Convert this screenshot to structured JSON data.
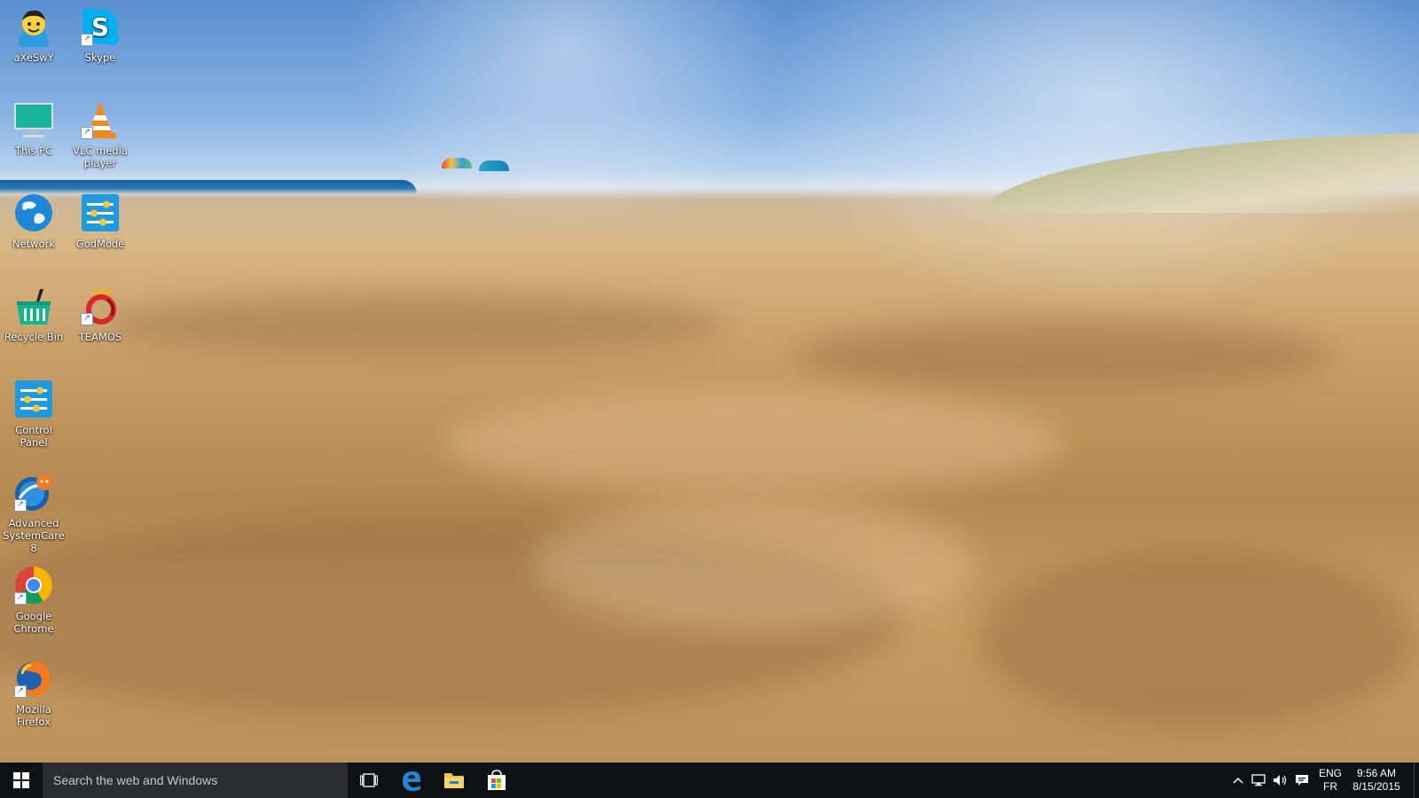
{
  "desktop": {
    "icons": [
      {
        "label": "aXeSwY",
        "icon": "user-avatar-icon"
      },
      {
        "label": "Skype",
        "icon": "skype-icon"
      },
      {
        "label": "This PC",
        "icon": "monitor-icon"
      },
      {
        "label": "VLC media player",
        "icon": "vlc-cone-icon"
      },
      {
        "label": "Network",
        "icon": "network-globe-icon"
      },
      {
        "label": "GodMode",
        "icon": "control-panel-icon"
      },
      {
        "label": "Recycle Bin",
        "icon": "recycle-bin-icon"
      },
      {
        "label": "TEAMOS",
        "icon": "teamos-icon"
      },
      {
        "label": "Control Panel",
        "icon": "control-panel-icon"
      },
      {
        "label": "Advanced SystemCare 8",
        "icon": "advanced-systemcare-icon"
      },
      {
        "label": "Google Chrome",
        "icon": "chrome-icon"
      },
      {
        "label": "Mozilla Firefox",
        "icon": "firefox-icon"
      }
    ]
  },
  "taskbar": {
    "search_placeholder": "Search the web and Windows",
    "pinned": [
      "task-view-icon",
      "edge-icon",
      "file-explorer-icon",
      "store-icon"
    ],
    "tray": {
      "lang_top": "ENG",
      "lang_bottom": "FR",
      "time": "9:56 AM",
      "date": "8/15/2015"
    }
  },
  "colors": {
    "taskbar_bg": "#0e1215",
    "search_bg": "#2b2d30",
    "accent_blue": "#1e88d6"
  }
}
